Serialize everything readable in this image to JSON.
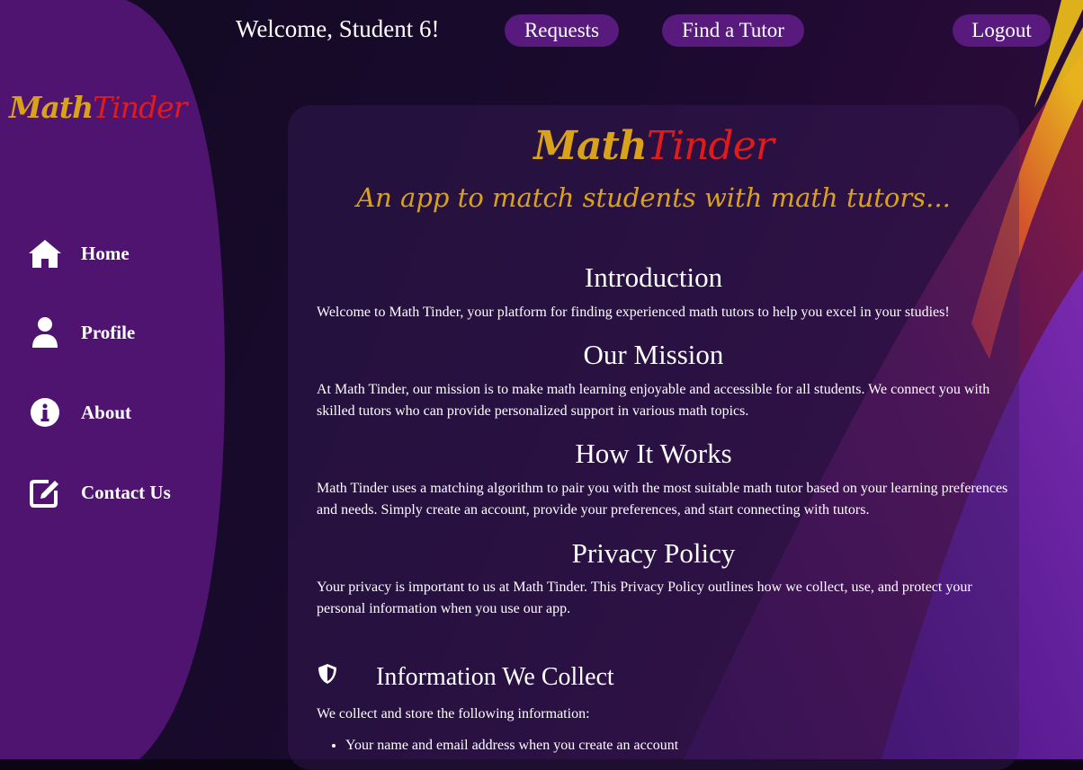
{
  "header": {
    "welcome": "Welcome, Student 6!",
    "requests_label": "Requests",
    "find_tutor_label": "Find a Tutor",
    "logout_label": "Logout"
  },
  "brand": {
    "part1": "Math",
    "part2": "Tinder",
    "tagline": "An app to match students with math tutors..."
  },
  "sidebar": {
    "items": [
      {
        "label": "Home",
        "icon": "home-icon"
      },
      {
        "label": "Profile",
        "icon": "user-icon"
      },
      {
        "label": "About",
        "icon": "info-icon"
      },
      {
        "label": "Contact Us",
        "icon": "edit-icon"
      }
    ]
  },
  "sections": [
    {
      "title": "Introduction",
      "text": "Welcome to Math Tinder, your platform for finding experienced math tutors to help you excel in your studies!"
    },
    {
      "title": "Our Mission",
      "text": "At Math Tinder, our mission is to make math learning enjoyable and accessible for all students. We connect you with skilled tutors who can provide personalized support in various math topics."
    },
    {
      "title": "How It Works",
      "text": "Math Tinder uses a matching algorithm to pair you with the most suitable math tutor based on your learning preferences and needs. Simply create an account, provide your preferences, and start connecting with tutors."
    },
    {
      "title": "Privacy Policy",
      "text": "Your privacy is important to us at Math Tinder. This Privacy Policy outlines how we collect, use, and protect your personal information when you use our app."
    }
  ],
  "info": {
    "title": "Information We Collect",
    "icon": "shield-icon",
    "intro": "We collect and store the following information:",
    "items": [
      "Your name and email address when you create an account"
    ]
  },
  "colors": {
    "brand_gold": "#d9a21a",
    "brand_red": "#e01b1b",
    "sidebar_purple": "#4f1470",
    "pill_purple": "#581a7d"
  }
}
